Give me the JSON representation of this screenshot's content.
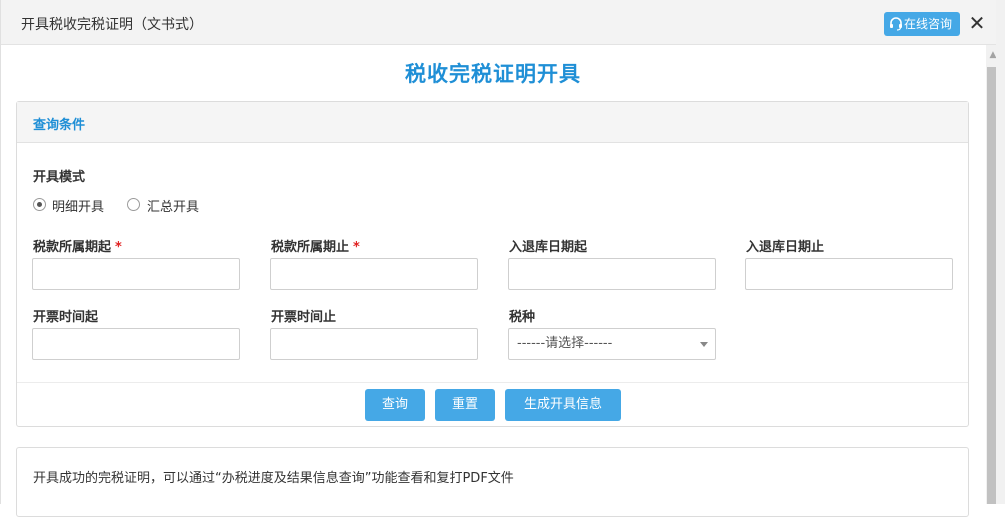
{
  "dialog": {
    "title": "开具税收完税证明（文书式）",
    "consult_label": "在线咨询",
    "close_label": "✕"
  },
  "page": {
    "main_title": "税收完税证明开具"
  },
  "query_panel": {
    "title": "查询条件",
    "mode_label": "开具模式",
    "mode_options": [
      {
        "label": "明细开具",
        "checked": true
      },
      {
        "label": "汇总开具",
        "checked": false
      }
    ],
    "fields": [
      {
        "label": "税款所属期起",
        "required": "*",
        "value": ""
      },
      {
        "label": "税款所属期止",
        "required": "*",
        "value": ""
      },
      {
        "label": "入退库日期起",
        "value": ""
      },
      {
        "label": "入退库日期止",
        "value": ""
      },
      {
        "label": "开票时间起",
        "value": ""
      },
      {
        "label": "开票时间止",
        "value": ""
      }
    ],
    "tax_type": {
      "label": "税种",
      "selected": "------请选择------"
    },
    "buttons": {
      "query": "查询",
      "reset": "重置",
      "generate": "生成开具信息"
    }
  },
  "note": {
    "text": "开具成功的完税证明，可以通过“办税进度及结果信息查询”功能查看和复打PDF文件"
  },
  "colors": {
    "accent": "#1f8fd6",
    "button": "#45a8e6",
    "required": "#e02020"
  }
}
